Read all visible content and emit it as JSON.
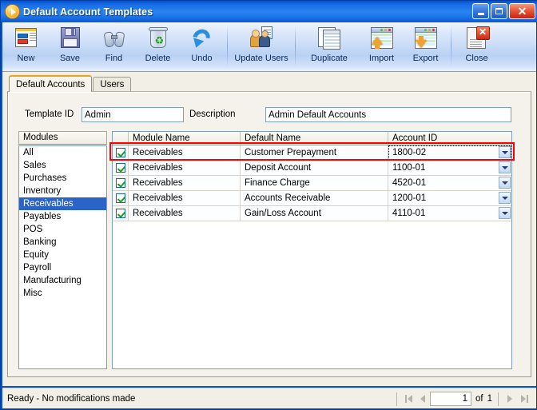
{
  "window": {
    "title": "Default Account Templates",
    "title_icon": "orange-play-circle-icon",
    "minimize_label": "_",
    "maximize_label": "",
    "close_label": "✕"
  },
  "toolbar": {
    "items": [
      {
        "label": "New",
        "icon": "new-document-icon"
      },
      {
        "label": "Save",
        "icon": "floppy-disk-icon"
      },
      {
        "label": "Find",
        "icon": "binoculars-icon"
      },
      {
        "label": "Delete",
        "icon": "recycle-bin-icon"
      },
      {
        "label": "Undo",
        "icon": "undo-arrow-icon"
      },
      {
        "label": "Update Users",
        "icon": "users-update-icon"
      },
      {
        "label": "Duplicate",
        "icon": "duplicate-window-icon"
      },
      {
        "label": "Import",
        "icon": "import-grid-icon"
      },
      {
        "label": "Export",
        "icon": "export-grid-icon"
      },
      {
        "label": "Close",
        "icon": "close-document-icon"
      }
    ]
  },
  "tabs": [
    {
      "label": "Default Accounts",
      "active": true
    },
    {
      "label": "Users",
      "active": false
    }
  ],
  "form": {
    "template_id_label": "Template ID",
    "template_id_value": "Admin",
    "description_label": "Description",
    "description_value": "Admin Default Accounts"
  },
  "modules": {
    "header": "Modules",
    "items": [
      {
        "label": "All",
        "selected": false
      },
      {
        "label": "Sales",
        "selected": false
      },
      {
        "label": "Purchases",
        "selected": false
      },
      {
        "label": "Inventory",
        "selected": false
      },
      {
        "label": "Receivables",
        "selected": true
      },
      {
        "label": "Payables",
        "selected": false
      },
      {
        "label": "POS",
        "selected": false
      },
      {
        "label": "Banking",
        "selected": false
      },
      {
        "label": "Equity",
        "selected": false
      },
      {
        "label": "Payroll",
        "selected": false
      },
      {
        "label": "Manufacturing",
        "selected": false
      },
      {
        "label": "Misc",
        "selected": false
      }
    ]
  },
  "grid": {
    "columns": [
      "",
      "Module Name",
      "Default Name",
      "Account ID"
    ],
    "rows": [
      {
        "checked": true,
        "module": "Receivables",
        "default_name": "Customer Prepayment",
        "account_id": "1800-02",
        "focused": true
      },
      {
        "checked": true,
        "module": "Receivables",
        "default_name": "Deposit Account",
        "account_id": "1100-01",
        "focused": false
      },
      {
        "checked": true,
        "module": "Receivables",
        "default_name": "Finance Charge",
        "account_id": "4520-01",
        "focused": false
      },
      {
        "checked": true,
        "module": "Receivables",
        "default_name": "Accounts Receivable",
        "account_id": "1200-01",
        "focused": false
      },
      {
        "checked": true,
        "module": "Receivables",
        "default_name": "Gain/Loss Account",
        "account_id": "4110-01",
        "focused": false
      }
    ]
  },
  "statusbar": {
    "message": "Ready - No modifications made",
    "page_current": "1",
    "page_of": "of",
    "page_total": "1"
  },
  "colors": {
    "title_blue": "#1c74ea",
    "accent_orange": "#f0a022",
    "selection_blue": "#2a64c8",
    "annotation_red": "#ff0000",
    "panel_beige": "#f4f2ea",
    "close_red": "#cc2a12"
  }
}
